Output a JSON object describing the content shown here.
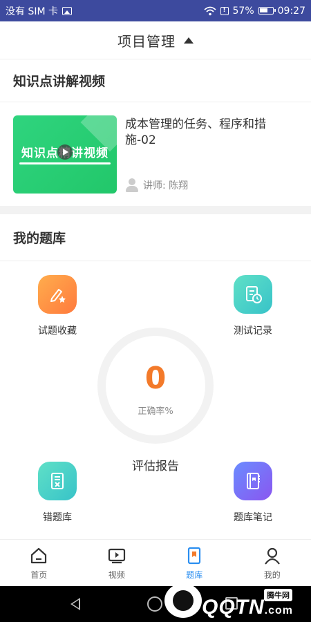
{
  "status_bar": {
    "carrier": "没有 SIM 卡",
    "battery": "57%",
    "time": "09:27"
  },
  "header": {
    "title": "项目管理"
  },
  "video_section": {
    "title": "知识点讲解视频",
    "item": {
      "thumbnail_text": "知识点精讲视频",
      "title": "成本管理的任务、程序和措施-02",
      "lecturer": "讲师: 陈翔"
    }
  },
  "bank_section": {
    "title": "我的题库",
    "features": {
      "favorites": "试题收藏",
      "records": "测试记录",
      "wrong": "错题库",
      "notes": "题库笔记"
    },
    "accuracy": {
      "value": "0",
      "label": "正确率%"
    },
    "report": "评估报告"
  },
  "bottom_nav": {
    "items": [
      {
        "label": "首页"
      },
      {
        "label": "视频"
      },
      {
        "label": "题库"
      },
      {
        "label": "我的"
      }
    ],
    "active_color": "#2a8ef0"
  },
  "watermark": {
    "badge": "腾牛网",
    "text": "QQTN",
    "suffix": ".com"
  },
  "colors": {
    "status_bar": "#3d4a9e",
    "accent_orange": "#f37a2a",
    "thumb_green": "#2fd47e"
  }
}
